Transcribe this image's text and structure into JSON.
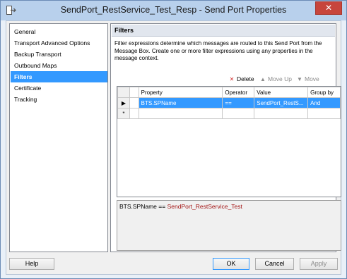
{
  "window": {
    "title": "SendPort_RestService_Test_Resp - Send Port Properties",
    "close_label": "✕"
  },
  "nav": {
    "items": [
      {
        "label": "General"
      },
      {
        "label": "Transport Advanced Options"
      },
      {
        "label": "Backup Transport"
      },
      {
        "label": "Outbound Maps"
      },
      {
        "label": "Filters",
        "selected": true
      },
      {
        "label": "Certificate"
      },
      {
        "label": "Tracking"
      }
    ]
  },
  "panel": {
    "header": "Filters",
    "description": "Filter expressions determine which messages are routed to this Send Port from the Message Box. Create one or more filter expressions using any properties in the message context.",
    "toolbar": {
      "delete_label": "Delete",
      "move_up_label": "Move Up",
      "move_down_label": "Move Down",
      "delete_icon": "✕",
      "move_up_icon": "▲",
      "move_down_icon": "▼"
    },
    "grid": {
      "columns": [
        "Property",
        "Operator",
        "Value",
        "Group by"
      ],
      "rows": [
        {
          "marker": "▶",
          "property": "BTS.SPName",
          "operator": "==",
          "value": "SendPort_RestS...",
          "group_by": "And"
        },
        {
          "marker": "*",
          "property": "",
          "operator": "",
          "value": "",
          "group_by": ""
        }
      ]
    },
    "expression": {
      "lhs": "BTS.SPName",
      "op": "==",
      "rhs": "SendPort_RestService_Test"
    }
  },
  "buttons": {
    "help": "Help",
    "ok": "OK",
    "cancel": "Cancel",
    "apply": "Apply"
  },
  "colors": {
    "selection": "#3399ff",
    "title_bar": "#b8d0ec",
    "close": "#c7453c",
    "expression_value": "#a31515"
  }
}
